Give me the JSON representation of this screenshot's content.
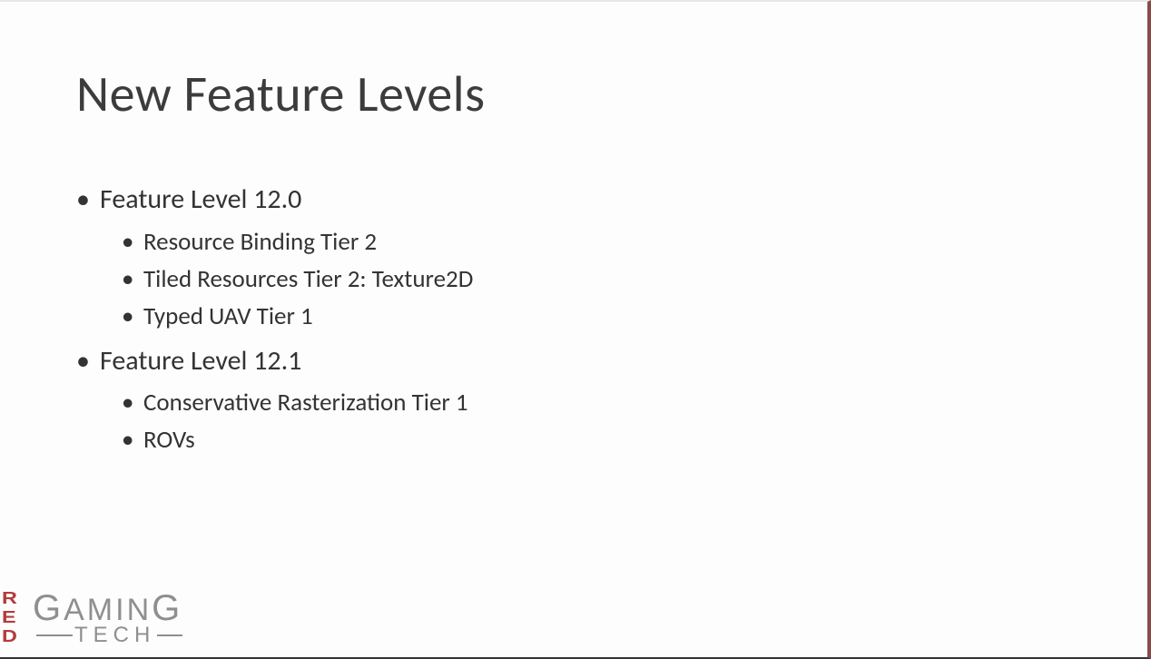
{
  "slide": {
    "title": "New Feature Levels",
    "items": [
      {
        "label": "Feature Level 12.0",
        "children": [
          "Resource Binding Tier 2",
          "Tiled Resources Tier 2: Texture2D",
          "Typed UAV Tier 1"
        ]
      },
      {
        "label": "Feature Level 12.1",
        "children": [
          "Conservative Rasterization Tier 1",
          "ROVs"
        ]
      }
    ]
  },
  "logo": {
    "red": [
      "R",
      "E",
      "D"
    ],
    "gaming": "GAMING",
    "tech": "TECH"
  }
}
